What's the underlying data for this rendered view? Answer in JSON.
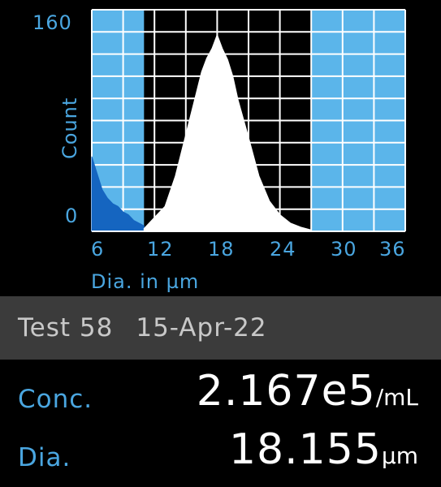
{
  "histogram": {
    "ylabel": "Count",
    "xlabel": "Dia. in µm",
    "y_ticks": [
      "160",
      "0"
    ],
    "x_ticks": [
      "6",
      "12",
      "18",
      "24",
      "30",
      "36"
    ],
    "colors": {
      "gated_region": "#5bb5ea",
      "grid": "#ffffff",
      "accent": "#4aa6e0",
      "debris_fill": "#1565c0",
      "cells_fill": "#ffffff"
    }
  },
  "chart_data": {
    "type": "area",
    "xlabel": "Dia. in µm",
    "ylabel": "Count",
    "xlim": [
      6,
      36
    ],
    "ylim": [
      0,
      160
    ],
    "gate": [
      11,
      27
    ],
    "grid": true,
    "series": [
      {
        "x": [
          6,
          6.5,
          7,
          7.5,
          8,
          8.5,
          9,
          9.5,
          10,
          10.5,
          11
        ],
        "values": [
          54,
          42,
          30,
          24,
          20,
          18,
          14,
          12,
          8,
          6,
          4
        ]
      },
      {
        "x": [
          11,
          12,
          13,
          14,
          15,
          16,
          16.5,
          17,
          17.5,
          18,
          18.5,
          19,
          19.5,
          20,
          21,
          22,
          23,
          24,
          25,
          26,
          27
        ],
        "values": [
          2,
          10,
          18,
          40,
          70,
          100,
          115,
          125,
          132,
          142,
          132,
          124,
          112,
          95,
          68,
          40,
          22,
          12,
          6,
          3,
          1
        ]
      }
    ]
  },
  "test": {
    "label": "Test 58",
    "date": "15-Apr-22"
  },
  "readouts": {
    "concentration": {
      "label": "Conc.",
      "value": "2.167e5",
      "unit": "/mL"
    },
    "diameter": {
      "label": "Dia.",
      "value": "18.155",
      "unit": "µm"
    }
  }
}
